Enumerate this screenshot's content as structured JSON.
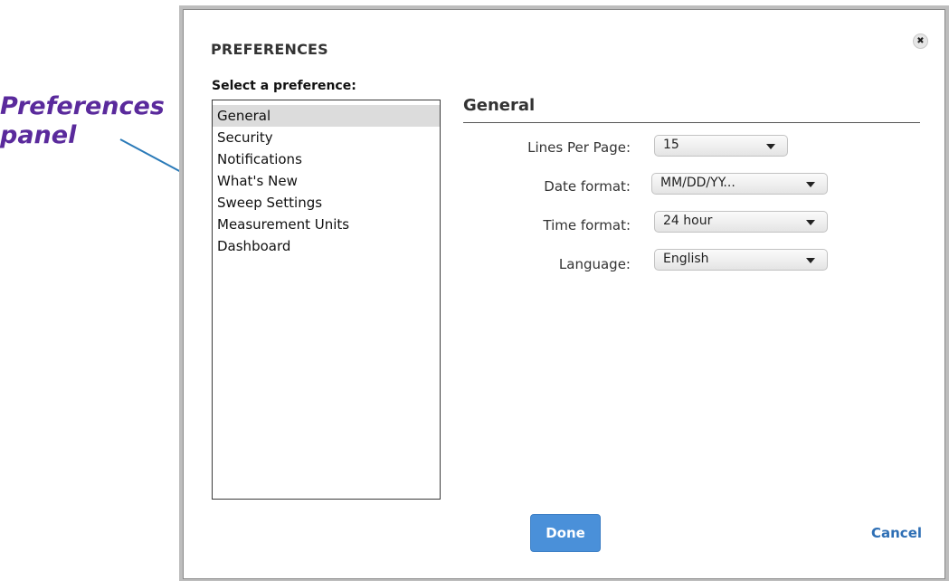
{
  "callout": {
    "line1": "Preferences",
    "line2": "panel",
    "color": "#5a2a9c",
    "arrow_color": "#2a7ab8"
  },
  "dialog": {
    "title": "PREFERENCES",
    "close_icon": "close-icon",
    "select_label": "Select a preference:",
    "preferences": [
      {
        "label": "General",
        "selected": true
      },
      {
        "label": "Security",
        "selected": false
      },
      {
        "label": "Notifications",
        "selected": false
      },
      {
        "label": "What's New",
        "selected": false
      },
      {
        "label": "Sweep Settings",
        "selected": false
      },
      {
        "label": "Measurement Units",
        "selected": false
      },
      {
        "label": "Dashboard",
        "selected": false
      }
    ],
    "section_title": "General",
    "fields": {
      "lines_per_page": {
        "label": "Lines Per Page:",
        "value": "15"
      },
      "date_format": {
        "label": "Date format:",
        "value": "MM/DD/YY..."
      },
      "time_format": {
        "label": "Time format:",
        "value": "24 hour"
      },
      "language": {
        "label": "Language:",
        "value": "English"
      }
    },
    "done_label": "Done",
    "cancel_label": "Cancel",
    "accent_color": "#4a90d9"
  }
}
